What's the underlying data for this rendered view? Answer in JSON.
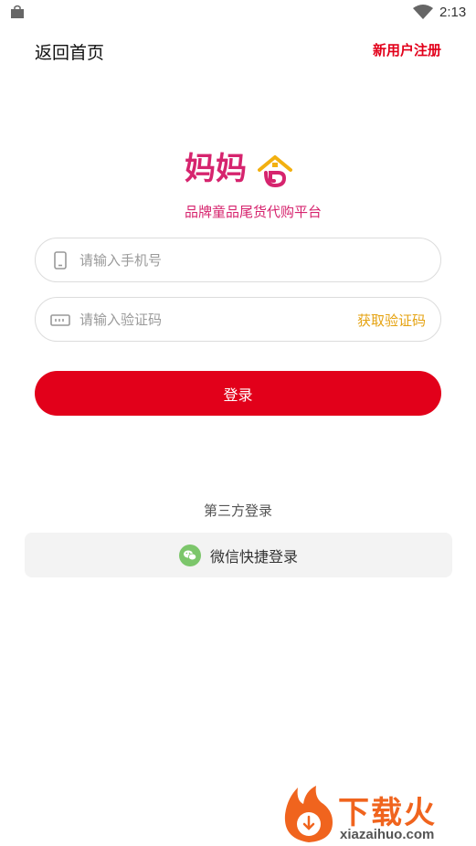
{
  "status_bar": {
    "time": "2:13"
  },
  "nav": {
    "back_label": "返回首页",
    "register_label": "新用户注册"
  },
  "brand": {
    "logo_text": "妈妈",
    "slogan": "品牌童品尾货代购平台"
  },
  "form": {
    "phone_placeholder": "请输入手机号",
    "phone_value": "",
    "code_placeholder": "请输入验证码",
    "code_value": "",
    "get_code_label": "获取验证码",
    "login_label": "登录"
  },
  "third_party": {
    "title": "第三方登录",
    "wechat_label": "微信快捷登录"
  },
  "watermark": {
    "title": "下载火",
    "url": "xiazaihuo.com"
  },
  "colors": {
    "primary": "#e2001a",
    "brand_pink": "#d6246e",
    "accent_orange": "#e5a210",
    "wechat_green": "#7cc66b"
  }
}
